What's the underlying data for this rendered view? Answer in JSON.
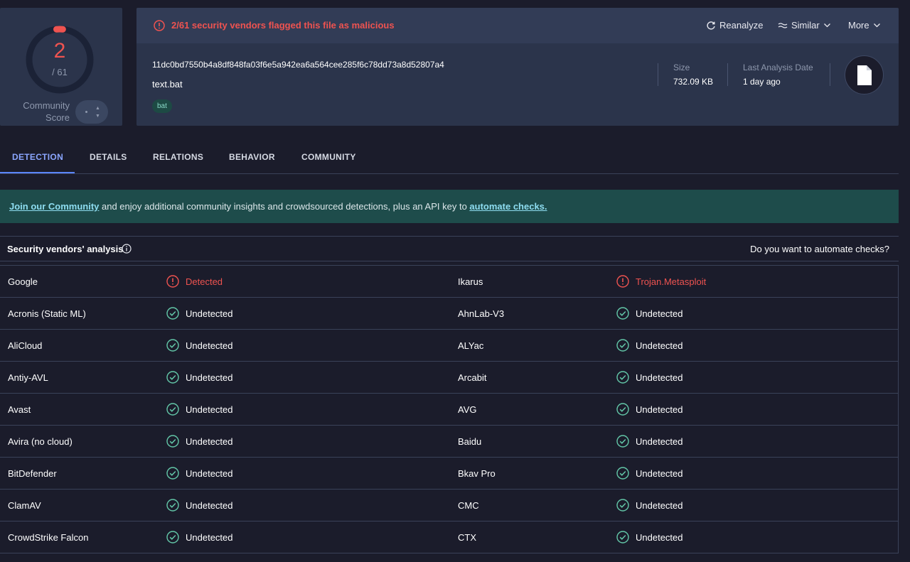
{
  "score": {
    "detected": "2",
    "total": "/ 61",
    "community_label_1": "Community",
    "community_label_2": "Score",
    "ring_fraction": 0.0328
  },
  "alert": {
    "text": "2/61 security vendors flagged this file as malicious"
  },
  "actions": {
    "reanalyze": "Reanalyze",
    "similar": "Similar",
    "more": "More"
  },
  "file": {
    "hash": "11dc0bd7550b4a8df848fa03f6e5a942ea6a564cee285f6c78dd73a8d52807a4",
    "name": "text.bat",
    "tag": "bat",
    "size_label": "Size",
    "size_value": "732.09 KB",
    "date_label": "Last Analysis Date",
    "date_value": "1 day ago"
  },
  "tabs": [
    "DETECTION",
    "DETAILS",
    "RELATIONS",
    "BEHAVIOR",
    "COMMUNITY"
  ],
  "banner": {
    "link1": "Join our Community",
    "middle": " and enjoy additional community insights and crowdsourced detections, plus an API key to ",
    "link2": "automate checks."
  },
  "vendors_header": {
    "title": "Security vendors' analysis",
    "automate": "Do you want to automate checks?"
  },
  "vendors": [
    {
      "left": {
        "name": "Google",
        "result": "Detected",
        "status": "detected"
      },
      "right": {
        "name": "Ikarus",
        "result": "Trojan.Metasploit",
        "status": "detected"
      }
    },
    {
      "left": {
        "name": "Acronis (Static ML)",
        "result": "Undetected",
        "status": "clean"
      },
      "right": {
        "name": "AhnLab-V3",
        "result": "Undetected",
        "status": "clean"
      }
    },
    {
      "left": {
        "name": "AliCloud",
        "result": "Undetected",
        "status": "clean"
      },
      "right": {
        "name": "ALYac",
        "result": "Undetected",
        "status": "clean"
      }
    },
    {
      "left": {
        "name": "Antiy-AVL",
        "result": "Undetected",
        "status": "clean"
      },
      "right": {
        "name": "Arcabit",
        "result": "Undetected",
        "status": "clean"
      }
    },
    {
      "left": {
        "name": "Avast",
        "result": "Undetected",
        "status": "clean"
      },
      "right": {
        "name": "AVG",
        "result": "Undetected",
        "status": "clean"
      }
    },
    {
      "left": {
        "name": "Avira (no cloud)",
        "result": "Undetected",
        "status": "clean"
      },
      "right": {
        "name": "Baidu",
        "result": "Undetected",
        "status": "clean"
      }
    },
    {
      "left": {
        "name": "BitDefender",
        "result": "Undetected",
        "status": "clean"
      },
      "right": {
        "name": "Bkav Pro",
        "result": "Undetected",
        "status": "clean"
      }
    },
    {
      "left": {
        "name": "ClamAV",
        "result": "Undetected",
        "status": "clean"
      },
      "right": {
        "name": "CMC",
        "result": "Undetected",
        "status": "clean"
      }
    },
    {
      "left": {
        "name": "CrowdStrike Falcon",
        "result": "Undetected",
        "status": "clean"
      },
      "right": {
        "name": "CTX",
        "result": "Undetected",
        "status": "clean"
      }
    }
  ],
  "colors": {
    "malicious": "#ef5350",
    "clean": "#63c7a8",
    "accent": "#5b86ff",
    "banner_bg": "#1e4c4b"
  }
}
